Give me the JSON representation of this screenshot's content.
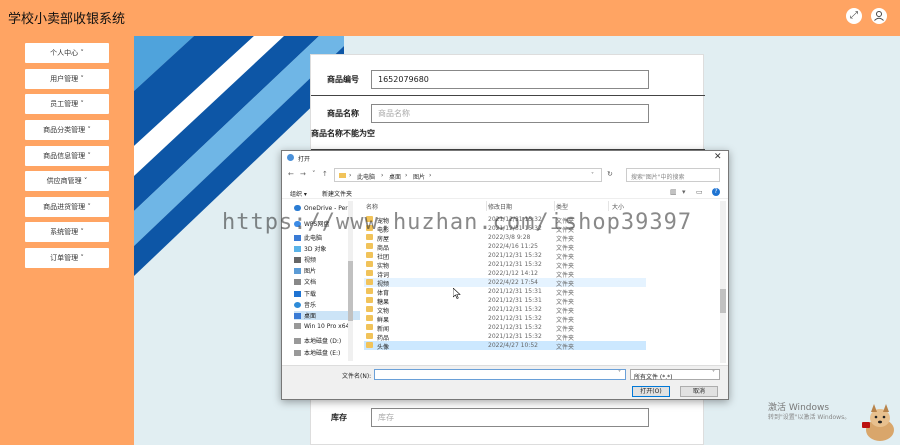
{
  "app": {
    "title": "学校小卖部收银系统"
  },
  "sidebar": {
    "items": [
      {
        "label": "个人中心 ˅"
      },
      {
        "label": "用户管理 ˅"
      },
      {
        "label": "员工管理 ˅"
      },
      {
        "label": "商品分类管理 ˅"
      },
      {
        "label": "商品信息管理 ˅"
      },
      {
        "label": "供应商管理 ˅"
      },
      {
        "label": "商品进货管理 ˅"
      },
      {
        "label": "系统管理 ˅"
      },
      {
        "label": "订单管理 ˅"
      }
    ]
  },
  "form": {
    "code_label": "商品编号",
    "code_value": "1652079680",
    "name_label": "商品名称",
    "name_placeholder": "商品名称",
    "name_error": "商品名称不能为空",
    "stock_label": "库存",
    "stock_placeholder": "库存"
  },
  "dialog": {
    "title": "打开",
    "close": "✕",
    "nav": {
      "back": "←",
      "forward": "→",
      "recent": "˅",
      "up": "↑"
    },
    "breadcrumb": [
      "此电脑",
      "›",
      "桌面",
      "›",
      "图片",
      "›"
    ],
    "refresh": "↻",
    "search_placeholder": "搜索\"图片\"中的搜索",
    "toolbar": {
      "organize": "组织 ▾",
      "new_folder": "新建文件夹"
    },
    "nav_pane": [
      {
        "label": "OneDrive - Pers",
        "icon": "cloud"
      },
      {
        "label": "WPS网盘",
        "icon": "cloud"
      },
      {
        "label": "此电脑",
        "icon": "pc"
      },
      {
        "label": "3D 对象",
        "icon": "cube"
      },
      {
        "label": "视频",
        "icon": "video"
      },
      {
        "label": "图片",
        "icon": "image"
      },
      {
        "label": "文档",
        "icon": "doc"
      },
      {
        "label": "下载",
        "icon": "download"
      },
      {
        "label": "音乐",
        "icon": "music"
      },
      {
        "label": "桌面",
        "icon": "desktop"
      },
      {
        "label": "Win 10 Pro x64",
        "icon": "drive"
      },
      {
        "label": "本地磁盘 (D:)",
        "icon": "drive"
      },
      {
        "label": "本地磁盘 (E:)",
        "icon": "drive"
      }
    ],
    "columns": {
      "name": "名称",
      "date": "修改日期",
      "type": "类型",
      "size": "大小"
    },
    "files": [
      {
        "name": "宠物",
        "date": "2021/12/31 15:32",
        "type": "文件夹"
      },
      {
        "name": "电影",
        "date": "2021/12/31 15:32",
        "type": "文件夹"
      },
      {
        "name": "房屋",
        "date": "2022/3/8 9:28",
        "type": "文件夹"
      },
      {
        "name": "商品",
        "date": "2022/4/16 11:25",
        "type": "文件夹"
      },
      {
        "name": "社团",
        "date": "2021/12/31 15:32",
        "type": "文件夹"
      },
      {
        "name": "实物",
        "date": "2021/12/31 15:32",
        "type": "文件夹"
      },
      {
        "name": "诗词",
        "date": "2022/1/12 14:12",
        "type": "文件夹"
      },
      {
        "name": "视频",
        "date": "2022/4/22 17:54",
        "type": "文件夹"
      },
      {
        "name": "体育",
        "date": "2021/12/31 15:31",
        "type": "文件夹"
      },
      {
        "name": "糖果",
        "date": "2021/12/31 15:31",
        "type": "文件夹"
      },
      {
        "name": "文物",
        "date": "2021/12/31 15:32",
        "type": "文件夹"
      },
      {
        "name": "鲜果",
        "date": "2021/12/31 15:32",
        "type": "文件夹"
      },
      {
        "name": "新闻",
        "date": "2021/12/31 15:32",
        "type": "文件夹"
      },
      {
        "name": "药品",
        "date": "2021/12/31 15:32",
        "type": "文件夹"
      },
      {
        "name": "头像",
        "date": "2022/4/27 10:52",
        "type": "文件夹"
      }
    ],
    "filename_label": "文件名(N):",
    "filename_value": "",
    "filetype": "所有文件 (*.*)",
    "open_label": "打开(O)",
    "cancel_label": "取消"
  },
  "overlay": {
    "watermark": "https://www.huzhan.com/ishop39397",
    "activate_title": "激活 Windows",
    "activate_sub": "转到\"设置\"以激活 Windows。"
  },
  "colors": {
    "accent": "#ffa463",
    "main_bg": "#e1eef2",
    "deco_dark": "#0d56a6",
    "deco_light": "#4fa3dc"
  }
}
